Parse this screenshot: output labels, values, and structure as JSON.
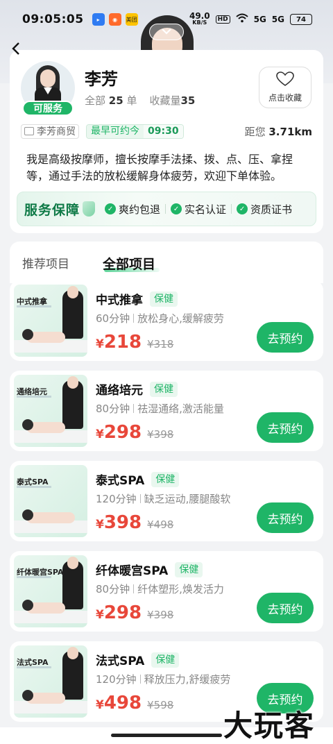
{
  "status_bar": {
    "time": "09:05:05",
    "network_speed": "49.0",
    "network_unit": "KB/S",
    "hd": "HD",
    "signal1": "5G",
    "signal2": "5G",
    "battery": "74",
    "app_icons": [
      "app-blue",
      "app-orange",
      "美团"
    ]
  },
  "profile": {
    "name": "李芳",
    "status_badge": "可服务",
    "orders_label": "全部",
    "orders_count": "25",
    "orders_unit": "单",
    "favorites_label": "收藏量",
    "favorites_count": "35",
    "favorite_button": "点击收藏",
    "shop_name": "李芳商贸",
    "earliest_label": "最早可约今",
    "earliest_time": "09:30",
    "distance_label": "距您",
    "distance_value": "3.71km",
    "bio": "我是高级按摩师，擅长按摩手法揉、拨、点、压、拿捏等，通过手法的放松缓解身体疲劳，欢迎下单体验。"
  },
  "guarantee": {
    "title": "服务保障",
    "items": [
      "爽约包退",
      "实名认证",
      "资质证书"
    ]
  },
  "tabs": [
    {
      "label": "推荐项目",
      "active": false
    },
    {
      "label": "全部项目",
      "active": true
    }
  ],
  "services": [
    {
      "name": "中式推拿",
      "image_label": "中式推拿",
      "tag": "保健",
      "duration": "60分钟",
      "desc": "放松身心,缓解疲劳",
      "price": "218",
      "old_price": "¥318",
      "button": "去预约"
    },
    {
      "name": "通络培元",
      "image_label": "通络培元",
      "tag": "保健",
      "duration": "80分钟",
      "desc": "祛湿通络,激活能量",
      "price": "298",
      "old_price": "¥398",
      "button": "去预约"
    },
    {
      "name": "泰式SPA",
      "image_label": "泰式SPA",
      "tag": "保健",
      "duration": "120分钟",
      "desc": "缺乏运动,腰腿酸软",
      "price": "398",
      "old_price": "¥498",
      "button": "去预约"
    },
    {
      "name": "纤体暖宫SPA",
      "image_label": "纤体暖宫SPA",
      "tag": "保健",
      "duration": "80分钟",
      "desc": "纤体塑形,焕发活力",
      "price": "298",
      "old_price": "¥398",
      "button": "去预约"
    },
    {
      "name": "法式SPA",
      "image_label": "法式SPA",
      "tag": "保健",
      "duration": "120分钟",
      "desc": "释放压力,舒缓疲劳",
      "price": "498",
      "old_price": "¥598",
      "button": "去预约"
    }
  ],
  "currency_symbol": "¥",
  "watermark": "大玩客",
  "colors": {
    "accent": "#1fb567",
    "price": "#e8473a"
  },
  "icons": {
    "back": "chevron-left-icon",
    "collapse": "chevron-down-icon",
    "favorite": "heart-icon",
    "check": "check-icon"
  }
}
